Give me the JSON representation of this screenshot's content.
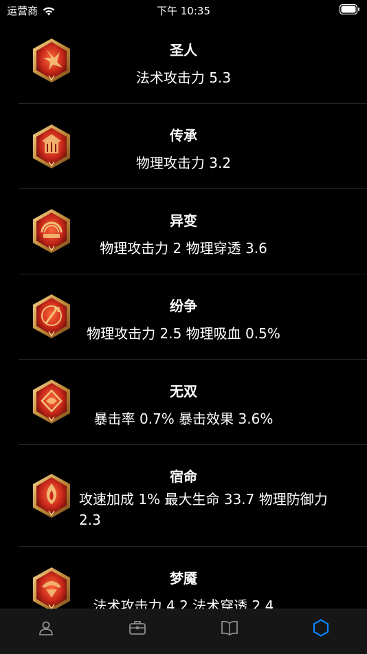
{
  "status_bar": {
    "carrier": "运营商",
    "time": "下午 10:35"
  },
  "rows": [
    {
      "title": "圣人",
      "desc": "法术攻击力 5.3",
      "icon": "saint-rune-icon"
    },
    {
      "title": "传承",
      "desc": "物理攻击力 3.2",
      "icon": "inheritance-rune-icon"
    },
    {
      "title": "异变",
      "desc": "物理攻击力 2 物理穿透 3.6",
      "icon": "mutation-rune-icon"
    },
    {
      "title": "纷争",
      "desc": "物理攻击力 2.5 物理吸血 0.5%",
      "icon": "strife-rune-icon"
    },
    {
      "title": "无双",
      "desc": "暴击率 0.7% 暴击效果 3.6%",
      "icon": "unrivaled-rune-icon"
    },
    {
      "title": "宿命",
      "desc": "攻速加成 1% 最大生命 33.7 物理防御力 2.3",
      "icon": "destiny-rune-icon"
    },
    {
      "title": "梦魇",
      "desc": "法术攻击力 4.2 法术穿透 2.4",
      "icon": "nightmare-rune-icon"
    }
  ],
  "tab_bar": {
    "tabs": [
      "profile-tab",
      "equipment-tab",
      "guide-tab",
      "runes-tab"
    ],
    "active": "runes-tab",
    "active_color": "#0a84ff",
    "inactive_color": "#8e8e93"
  }
}
